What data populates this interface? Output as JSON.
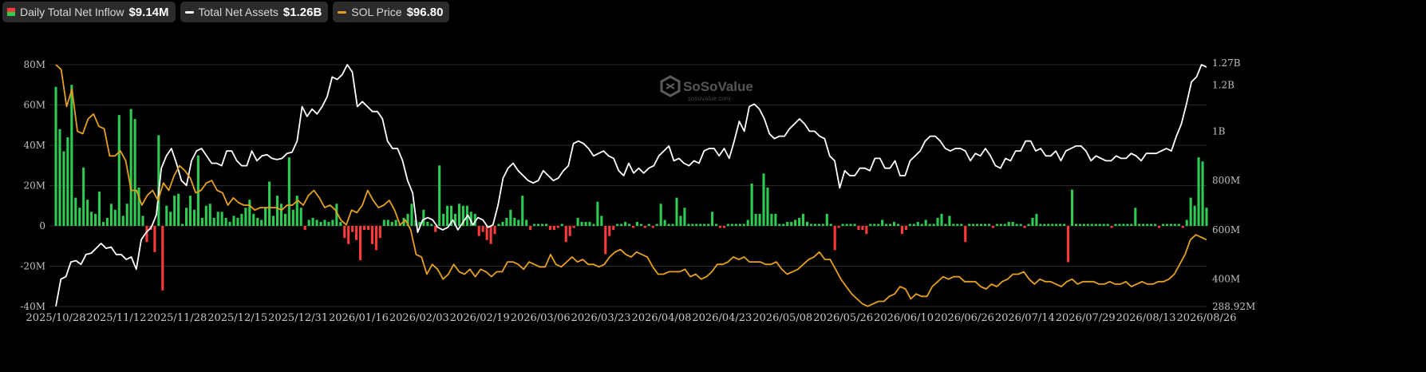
{
  "legend": [
    {
      "name": "Daily Total Net Inflow",
      "value": "$9.14M",
      "color_pos": "#2ecc52",
      "color_neg": "#ff3b3b"
    },
    {
      "name": "Total Net Assets",
      "value": "$1.26B",
      "color": "#ffffff"
    },
    {
      "name": "SOL Price",
      "value": "$96.80",
      "color": "#e6a020"
    }
  ],
  "watermark": {
    "brand": "SoSoValue",
    "sub": "sosovalue.com"
  },
  "colors": {
    "positive": "#2ecc52",
    "negative": "#ff3b3b",
    "assets": "#ffffff",
    "price": "#e6a020",
    "grid": "#2a2a2a",
    "background": "#000000"
  },
  "chart_data": {
    "type": "bar+line",
    "x_ticks": [
      "2025/10/28",
      "2025/11/12",
      "2025/11/28",
      "2025/12/15",
      "2025/12/31",
      "2026/01/16",
      "2026/02/03",
      "2026/02/19",
      "2026/03/06",
      "2026/03/23",
      "2026/04/08",
      "2026/04/23",
      "2026/05/08",
      "2026/05/26",
      "2026/06/10",
      "2026/06/26",
      "2026/07/14",
      "2026/07/29",
      "2026/08/13",
      "2026/08/26"
    ],
    "left_axis": {
      "labels": [
        "80M",
        "60M",
        "40M",
        "20M",
        "0",
        "-20M",
        "-40M"
      ],
      "range": [
        -40,
        80
      ],
      "unit": "M USD"
    },
    "right_axis": {
      "labels": [
        "1.27B",
        "1.2B",
        "1B",
        "800M",
        "600M",
        "400M",
        "288.92M"
      ],
      "values": [
        1270,
        1200,
        1000,
        800,
        600,
        400,
        288.92
      ],
      "range": [
        288.92,
        1270
      ],
      "unit": "M USD"
    },
    "series": [
      {
        "name": "Daily Total Net Inflow",
        "kind": "bar",
        "values": [
          69,
          48,
          37,
          44,
          70,
          14,
          9,
          29,
          13,
          7,
          6,
          17,
          2,
          4,
          11,
          8,
          55,
          5,
          11,
          58,
          53,
          19,
          5,
          -8,
          -2,
          -13,
          45,
          -32,
          10,
          7,
          15,
          16,
          1,
          9,
          15,
          8,
          35,
          4,
          10,
          11,
          4,
          7,
          7,
          4,
          2,
          5,
          4,
          6,
          9,
          13,
          6,
          4,
          3,
          9,
          22,
          5,
          15,
          11,
          6,
          34,
          8,
          15,
          9,
          -2,
          3,
          4,
          3,
          2,
          3,
          2,
          3,
          11,
          2,
          -6,
          -9,
          -3,
          -7,
          -17,
          -2,
          -2,
          -9,
          -12,
          -6,
          3,
          3,
          2,
          3,
          1,
          4,
          6,
          11,
          3,
          2,
          8,
          2,
          1,
          -3,
          30,
          6,
          10,
          10,
          6,
          11,
          10,
          10,
          7,
          6,
          -5,
          -3,
          -7,
          -9,
          -4,
          1,
          2,
          4,
          8,
          4,
          3,
          15,
          3,
          -2,
          1,
          1,
          1,
          1,
          -2,
          -2,
          -1,
          1,
          -8,
          -5,
          -1,
          4,
          2,
          2,
          2,
          1,
          12,
          5,
          -14,
          -5,
          -2,
          1,
          1,
          2,
          1,
          -1,
          2,
          1,
          -1,
          1,
          -1,
          1,
          11,
          3,
          1,
          1,
          14,
          5,
          9,
          1,
          1,
          1,
          1,
          1,
          1,
          7,
          1,
          -1,
          -1,
          1,
          1,
          1,
          1,
          1,
          3,
          21,
          6,
          6,
          26,
          19,
          6,
          6,
          1,
          1,
          2,
          2,
          3,
          4,
          6,
          2,
          1,
          1,
          1,
          1,
          6,
          1,
          -12,
          -1,
          1,
          1,
          1,
          1,
          -2,
          -2,
          -4,
          1,
          1,
          1,
          3,
          1,
          1,
          2,
          1,
          -4,
          -2,
          1,
          1,
          2,
          1,
          3,
          1,
          1,
          4,
          6,
          1,
          5,
          1,
          1,
          1,
          -8,
          1,
          1,
          1,
          1,
          1,
          1,
          -1,
          1,
          1,
          1,
          2,
          2,
          1,
          1,
          -1,
          1,
          4,
          6,
          1,
          1,
          1,
          1,
          1,
          1,
          1,
          -18,
          18,
          1,
          1,
          1,
          1,
          1,
          1,
          1,
          1,
          1,
          -1,
          1,
          1,
          1,
          1,
          1,
          9,
          1,
          1,
          1,
          1,
          1,
          -1,
          1,
          1,
          1,
          1,
          1,
          -1,
          3,
          14,
          10,
          34,
          32,
          9
        ]
      },
      {
        "name": "Total Net Assets",
        "kind": "line",
        "axis": "right",
        "values": [
          290,
          400,
          410,
          470,
          475,
          460,
          500,
          505,
          525,
          545,
          525,
          530,
          500,
          500,
          480,
          490,
          440,
          560,
          590,
          610,
          660,
          850,
          900,
          930,
          870,
          800,
          780,
          880,
          920,
          930,
          900,
          870,
          870,
          860,
          920,
          920,
          880,
          860,
          860,
          920,
          880,
          900,
          905,
          890,
          885,
          890,
          910,
          915,
          960,
          1100,
          1060,
          1090,
          1070,
          1100,
          1140,
          1220,
          1210,
          1230,
          1270,
          1240,
          1100,
          1120,
          1100,
          1080,
          1080,
          1050,
          960,
          930,
          930,
          880,
          800,
          750,
          590,
          640,
          650,
          640,
          610,
          600,
          610,
          640,
          600,
          630,
          660,
          620,
          650,
          640,
          610,
          620,
          700,
          810,
          850,
          870,
          840,
          820,
          800,
          790,
          800,
          840,
          820,
          800,
          810,
          840,
          860,
          950,
          960,
          950,
          930,
          900,
          910,
          920,
          900,
          890,
          840,
          820,
          870,
          830,
          850,
          830,
          850,
          860,
          900,
          920,
          940,
          880,
          890,
          870,
          860,
          880,
          870,
          920,
          930,
          930,
          900,
          930,
          890,
          960,
          1040,
          1000,
          1100,
          1110,
          1090,
          1050,
          990,
          970,
          980,
          980,
          1010,
          1030,
          1050,
          1030,
          1000,
          1000,
          980,
          970,
          900,
          880,
          770,
          840,
          820,
          820,
          850,
          850,
          840,
          890,
          890,
          850,
          850,
          880,
          820,
          820,
          880,
          900,
          920,
          960,
          980,
          980,
          960,
          930,
          920,
          930,
          930,
          920,
          880,
          910,
          900,
          930,
          900,
          860,
          850,
          890,
          880,
          920,
          920,
          960,
          960,
          920,
          930,
          900,
          900,
          920,
          880,
          920,
          930,
          940,
          940,
          920,
          880,
          900,
          890,
          880,
          880,
          900,
          890,
          890,
          910,
          900,
          880,
          910,
          910,
          910,
          920,
          930,
          920,
          980,
          1030,
          1110,
          1200,
          1220,
          1270,
          1260
        ]
      },
      {
        "name": "SOL Price",
        "kind": "line",
        "axis": "right",
        "values": [
          1270,
          1250,
          1100,
          1170,
          1000,
          990,
          1050,
          1070,
          1020,
          1010,
          900,
          900,
          920,
          880,
          760,
          760,
          700,
          740,
          760,
          720,
          790,
          760,
          820,
          860,
          840,
          810,
          750,
          760,
          790,
          800,
          760,
          750,
          700,
          730,
          710,
          700,
          700,
          680,
          690,
          690,
          690,
          690,
          680,
          700,
          700,
          720,
          700,
          740,
          760,
          730,
          690,
          700,
          680,
          640,
          620,
          680,
          670,
          700,
          760,
          720,
          690,
          700,
          720,
          680,
          620,
          640,
          600,
          500,
          490,
          420,
          460,
          440,
          400,
          420,
          460,
          430,
          420,
          440,
          410,
          440,
          430,
          410,
          430,
          430,
          470,
          470,
          460,
          440,
          470,
          460,
          450,
          450,
          500,
          460,
          450,
          470,
          490,
          470,
          480,
          460,
          460,
          450,
          460,
          490,
          510,
          520,
          500,
          490,
          510,
          500,
          490,
          450,
          420,
          420,
          430,
          430,
          430,
          440,
          410,
          420,
          400,
          410,
          430,
          460,
          460,
          470,
          490,
          480,
          490,
          470,
          470,
          470,
          460,
          460,
          470,
          440,
          420,
          430,
          440,
          460,
          480,
          490,
          510,
          480,
          480,
          440,
          400,
          370,
          340,
          320,
          300,
          290,
          300,
          310,
          310,
          330,
          340,
          370,
          360,
          320,
          340,
          330,
          330,
          370,
          390,
          410,
          400,
          410,
          410,
          390,
          390,
          390,
          370,
          360,
          380,
          370,
          390,
          400,
          420,
          420,
          430,
          400,
          380,
          400,
          390,
          390,
          380,
          370,
          390,
          400,
          380,
          390,
          390,
          390,
          380,
          380,
          390,
          380,
          380,
          390,
          370,
          380,
          390,
          380,
          380,
          390,
          390,
          400,
          420,
          460,
          500,
          560,
          580,
          570,
          560
        ]
      }
    ],
    "grid": true,
    "legend_position": "top-left"
  }
}
